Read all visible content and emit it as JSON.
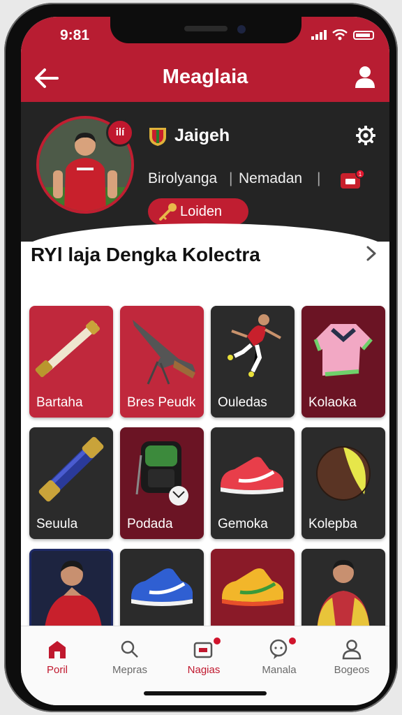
{
  "status_bar": {
    "time": "9:81"
  },
  "header": {
    "title": "Meaglaia"
  },
  "profile": {
    "name": "Jaigeh",
    "badge": "ilí",
    "sub_left": "Birolyanga",
    "sub_right": "Nemadan",
    "divider": "|",
    "pill_label": "Loiden",
    "notif_count": "1"
  },
  "section": {
    "title": "RYl laja Dengka Kolectra"
  },
  "items": [
    {
      "label": "Bartaha",
      "icon": "baton-icon"
    },
    {
      "label": "Bres Peudk",
      "icon": "rifle-icon"
    },
    {
      "label": "Ouledas",
      "icon": "player-kick-icon"
    },
    {
      "label": "Kolaoka",
      "icon": "jersey-icon"
    },
    {
      "label": "Seuula",
      "icon": "tube-icon"
    },
    {
      "label": "Podada",
      "icon": "backpack-icon"
    },
    {
      "label": "Gemoka",
      "icon": "sneaker-icon"
    },
    {
      "label": "Kolepba",
      "icon": "ball-icon"
    },
    {
      "label": "",
      "icon": "player-portrait-icon"
    },
    {
      "label": "",
      "icon": "blue-shoe-icon"
    },
    {
      "label": "",
      "icon": "yellow-shoe-icon"
    },
    {
      "label": "",
      "icon": "keeper-portrait-icon"
    }
  ],
  "tabs": [
    {
      "label": "Poril",
      "active": true
    },
    {
      "label": "Mepras",
      "active": false
    },
    {
      "label": "Nagias",
      "active": false
    },
    {
      "label": "Manala",
      "active": false
    },
    {
      "label": "Bogeos",
      "active": false
    }
  ],
  "colors": {
    "brand": "#b81d32",
    "profile_bg": "#242424"
  }
}
